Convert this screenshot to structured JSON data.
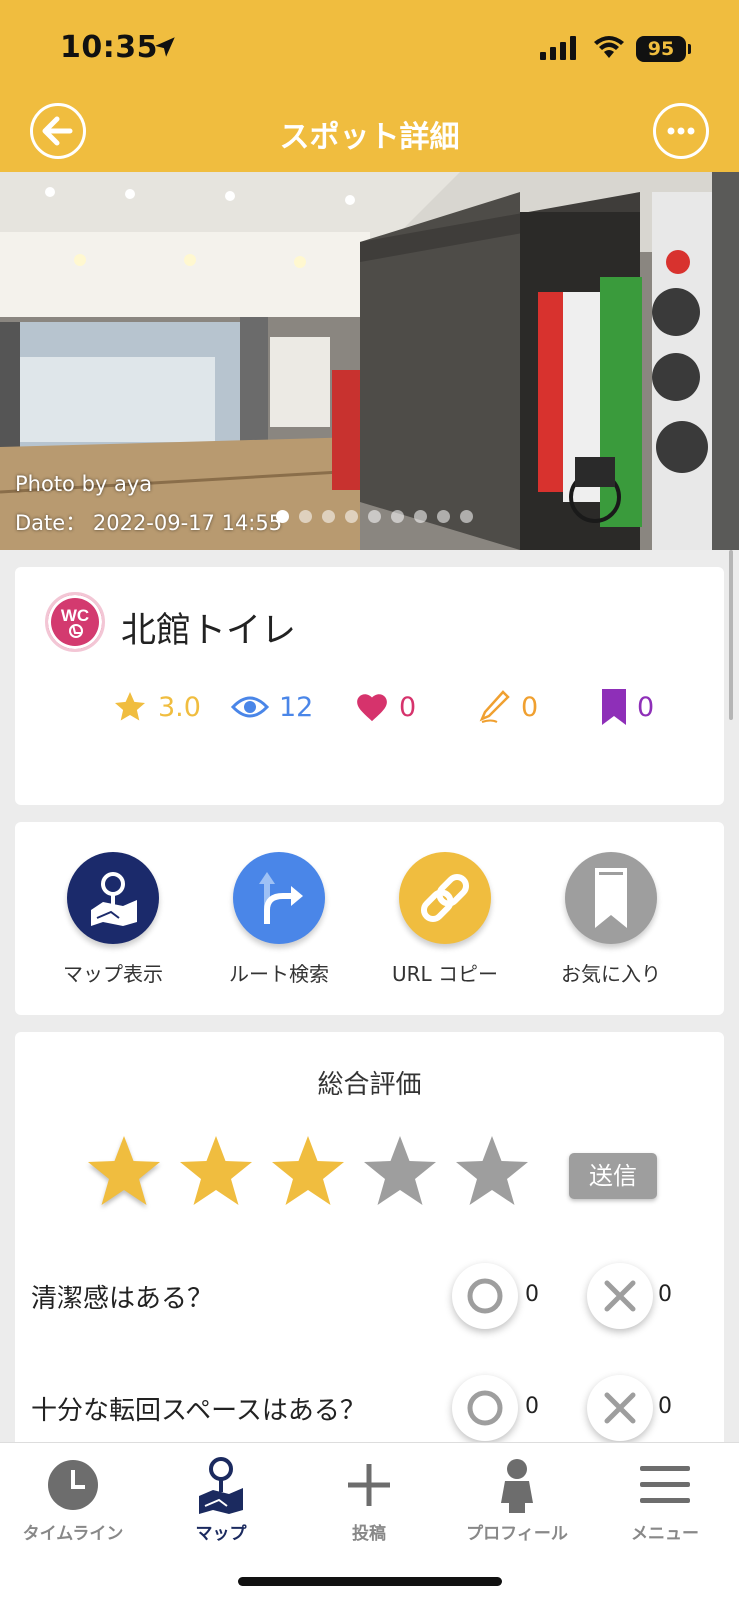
{
  "status_bar": {
    "time": "10:35",
    "battery": "95"
  },
  "header": {
    "title": "スポット詳細"
  },
  "photo": {
    "credit": "Photo by  aya",
    "date": "Date：  2022-09-17 14:55",
    "slide_count": 9,
    "active_slide": 1
  },
  "spot": {
    "badge": "WC",
    "name": "北館トイレ",
    "stats": {
      "rating": "3.0",
      "views": "12",
      "likes": "0",
      "reviews": "0",
      "bookmarks": "0"
    }
  },
  "actions": [
    {
      "label": "マップ表示",
      "icon": "map-pin-icon",
      "color": "#1b2a6b"
    },
    {
      "label": "ルート検索",
      "icon": "route-arrow-icon",
      "color": "#4a86e8"
    },
    {
      "label": "URL コピー",
      "icon": "link-icon",
      "color": "#f0bd3f"
    },
    {
      "label": "お気に入り",
      "icon": "bookmark-icon",
      "color": "#9e9e9e"
    }
  ],
  "rating": {
    "title": "総合評価",
    "stars_selected": 3,
    "stars_total": 5,
    "send_label": "送信",
    "questions": [
      {
        "text": "清潔感はある？",
        "yes_count": "0",
        "no_count": "0"
      },
      {
        "text": "十分な転回スペースはある？",
        "yes_count": "0",
        "no_count": "0"
      }
    ]
  },
  "tabbar": {
    "items": [
      {
        "label": "タイムライン",
        "icon": "clock-icon"
      },
      {
        "label": "マップ",
        "icon": "map-pin-icon",
        "active": true
      },
      {
        "label": "投稿",
        "icon": "plus-icon"
      },
      {
        "label": "プロフィール",
        "icon": "person-icon"
      },
      {
        "label": "メニュー",
        "icon": "hamburger-icon"
      }
    ]
  },
  "colors": {
    "header": "#f0bd3f",
    "rating": "#f0bd3f",
    "views": "#4a86e8",
    "likes": "#d6336c",
    "reviews": "#f0a030",
    "bookmarks": "#8e2fb8",
    "star_empty": "#9e9e9e",
    "nav_active": "#1b2a5f"
  }
}
